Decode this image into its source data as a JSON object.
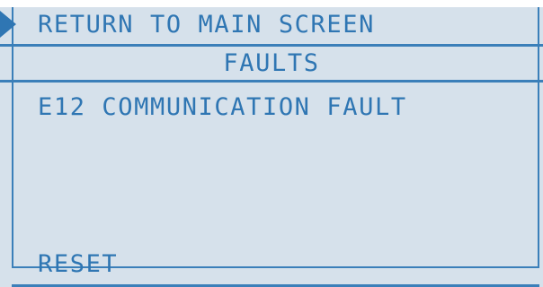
{
  "menu": {
    "return_label": "RETURN TO MAIN SCREEN",
    "title": "FAULTS",
    "fault_text": "E12 COMMUNICATION FAULT",
    "reset_label": "RESET"
  },
  "icons": {
    "cursor": "selection-arrow-icon"
  },
  "colors": {
    "background": "#d6e1eb",
    "text": "#2f76b3",
    "frame": "#3b7fb9"
  }
}
